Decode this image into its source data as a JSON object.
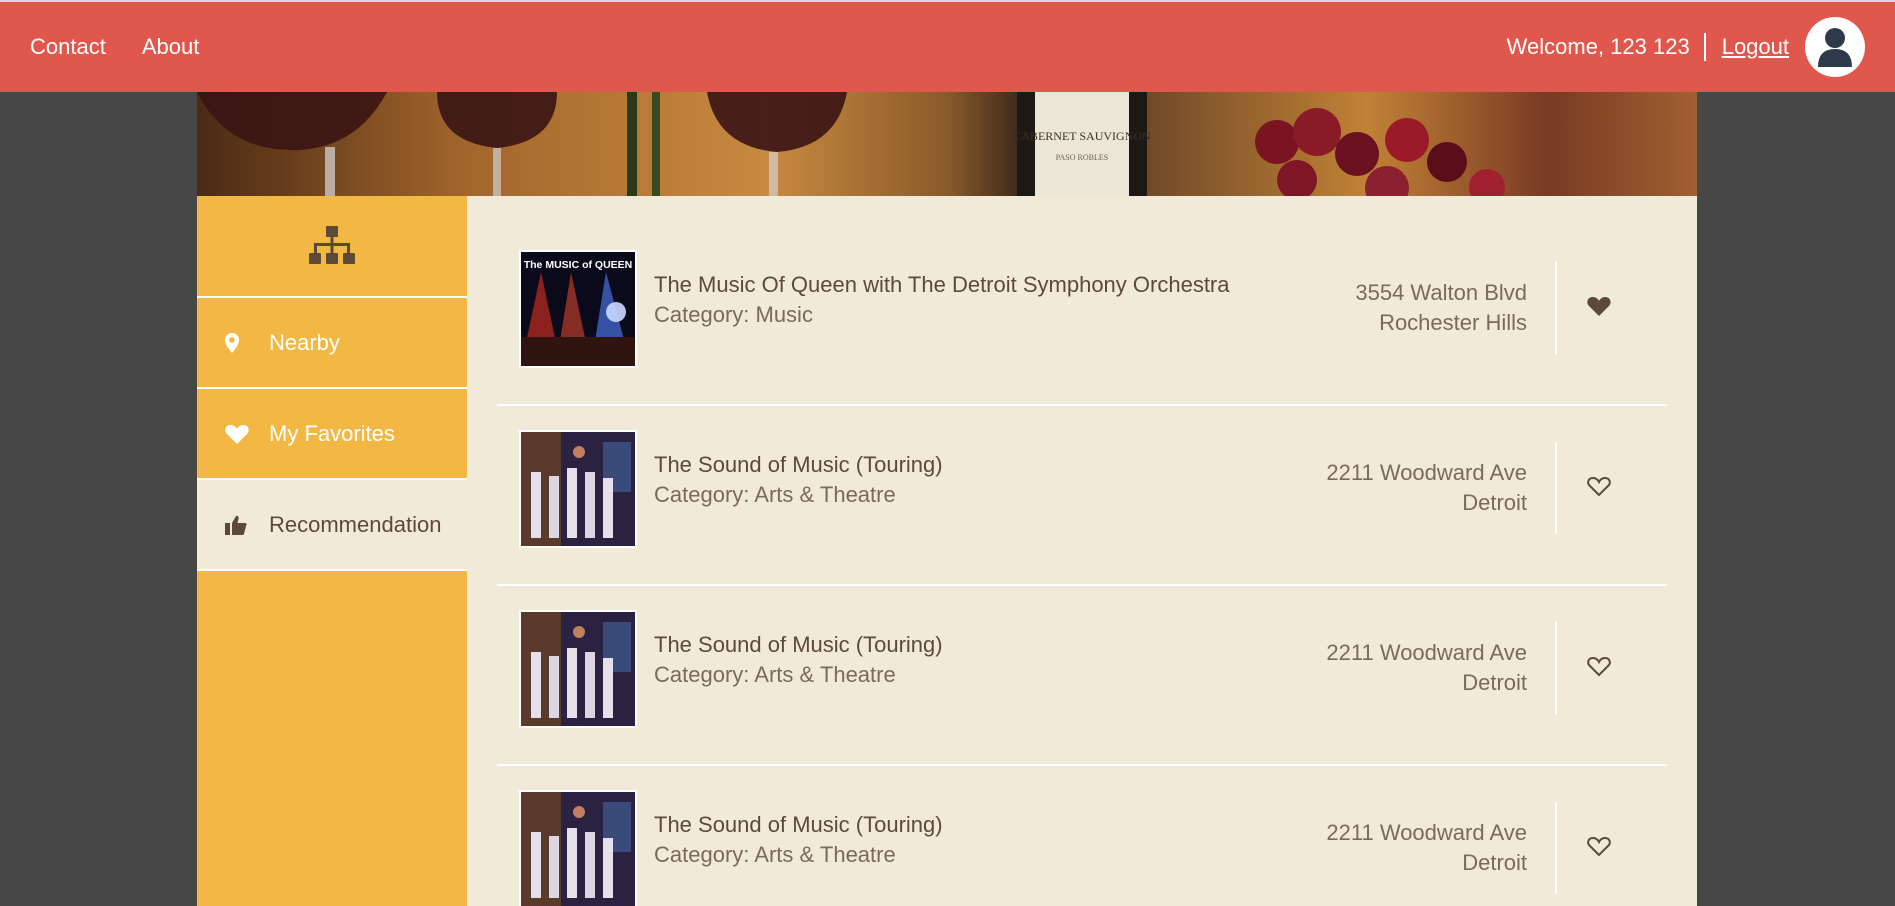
{
  "nav": {
    "contact": "Contact",
    "about": "About"
  },
  "user": {
    "welcome": "Welcome, 123 123",
    "logout": "Logout"
  },
  "sidebar": {
    "items": [
      {
        "label": "Nearby",
        "icon": "map-marker-icon",
        "active": false
      },
      {
        "label": "My Favorites",
        "icon": "heart-icon",
        "active": false
      },
      {
        "label": "Recommendation",
        "icon": "thumbs-up-icon",
        "active": true
      }
    ]
  },
  "events": [
    {
      "title": "The Music Of Queen with The Detroit Symphony Orchestra",
      "category": "Category: Music",
      "address1": "3554 Walton Blvd",
      "address2": "Rochester Hills",
      "favorite": true,
      "thumb_text": "The MUSIC of QUEEN"
    },
    {
      "title": "The Sound of Music (Touring)",
      "category": "Category: Arts & Theatre",
      "address1": "2211 Woodward Ave",
      "address2": "Detroit",
      "favorite": false
    },
    {
      "title": "The Sound of Music (Touring)",
      "category": "Category: Arts & Theatre",
      "address1": "2211 Woodward Ave",
      "address2": "Detroit",
      "favorite": false
    },
    {
      "title": "The Sound of Music (Touring)",
      "category": "Category: Arts & Theatre",
      "address1": "2211 Woodward Ave",
      "address2": "Detroit",
      "favorite": false
    }
  ],
  "banner": {
    "label": "CABERNET SAUVIGNON",
    "sublabel": "PASO ROBLES"
  },
  "colors": {
    "topbar": "#e0574d",
    "sidebar": "#f2b843",
    "content": "#f2ead8",
    "text": "#5c4a39",
    "page_bg": "#474747"
  }
}
